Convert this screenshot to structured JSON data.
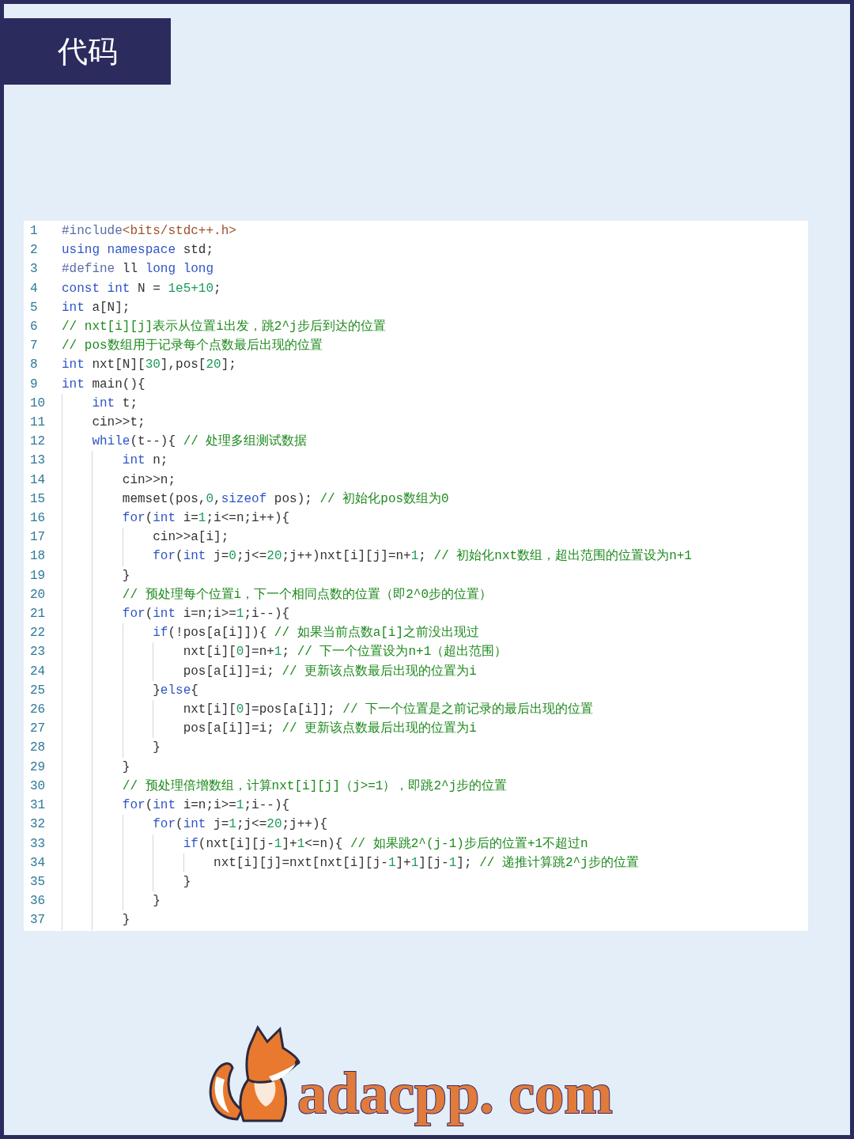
{
  "header": {
    "title": "代码"
  },
  "code": {
    "lines": [
      {
        "number": "1",
        "tokens": [
          {
            "kind": "pre",
            "text": "#include"
          },
          {
            "kind": "str",
            "text": "<bits/stdc++.h>"
          }
        ]
      },
      {
        "number": "2",
        "tokens": [
          {
            "kind": "kw",
            "text": "using"
          },
          {
            "kind": "kw",
            "text": " namespace"
          },
          {
            "kind": "plain",
            "text": " std;"
          }
        ]
      },
      {
        "number": "3",
        "tokens": [
          {
            "kind": "pre",
            "text": "#define"
          },
          {
            "kind": "plain",
            "text": " ll "
          },
          {
            "kind": "kw",
            "text": "long"
          },
          {
            "kind": "kw",
            "text": " long"
          }
        ]
      },
      {
        "number": "4",
        "tokens": [
          {
            "kind": "kw",
            "text": "const"
          },
          {
            "kind": "kw",
            "text": " int"
          },
          {
            "kind": "plain",
            "text": " N = "
          },
          {
            "kind": "num",
            "text": "1e5+10"
          },
          {
            "kind": "plain",
            "text": ";"
          }
        ]
      },
      {
        "number": "5",
        "tokens": [
          {
            "kind": "kw",
            "text": "int"
          },
          {
            "kind": "plain",
            "text": " a[N];"
          }
        ]
      },
      {
        "number": "6",
        "tokens": [
          {
            "kind": "com",
            "text": "// nxt[i][j]表示从位置i出发，跳2^j步后到达的位置"
          }
        ]
      },
      {
        "number": "7",
        "tokens": [
          {
            "kind": "com",
            "text": "// pos数组用于记录每个点数最后出现的位置"
          }
        ]
      },
      {
        "number": "8",
        "tokens": [
          {
            "kind": "kw",
            "text": "int"
          },
          {
            "kind": "plain",
            "text": " nxt[N]["
          },
          {
            "kind": "num",
            "text": "30"
          },
          {
            "kind": "plain",
            "text": "],pos["
          },
          {
            "kind": "num",
            "text": "20"
          },
          {
            "kind": "plain",
            "text": "];"
          }
        ]
      },
      {
        "number": "9",
        "tokens": [
          {
            "kind": "kw",
            "text": "int"
          },
          {
            "kind": "plain",
            "text": " main(){"
          }
        ]
      },
      {
        "number": "10",
        "tokens": [
          {
            "kind": "kw",
            "text": "    int"
          },
          {
            "kind": "plain",
            "text": " t;"
          }
        ]
      },
      {
        "number": "11",
        "tokens": [
          {
            "kind": "plain",
            "text": "    cin>>t;"
          }
        ]
      },
      {
        "number": "12",
        "tokens": [
          {
            "kind": "kw",
            "text": "    while"
          },
          {
            "kind": "plain",
            "text": "(t--){ "
          },
          {
            "kind": "com",
            "text": "// 处理多组测试数据"
          }
        ]
      },
      {
        "number": "13",
        "tokens": [
          {
            "kind": "kw",
            "text": "        int"
          },
          {
            "kind": "plain",
            "text": " n;"
          }
        ]
      },
      {
        "number": "14",
        "tokens": [
          {
            "kind": "plain",
            "text": "        cin>>n;"
          }
        ]
      },
      {
        "number": "15",
        "tokens": [
          {
            "kind": "plain",
            "text": "        memset(pos,"
          },
          {
            "kind": "num",
            "text": "0"
          },
          {
            "kind": "plain",
            "text": ","
          },
          {
            "kind": "kw",
            "text": "sizeof"
          },
          {
            "kind": "plain",
            "text": " pos); "
          },
          {
            "kind": "com",
            "text": "// 初始化pos数组为0"
          }
        ]
      },
      {
        "number": "16",
        "tokens": [
          {
            "kind": "kw",
            "text": "        for"
          },
          {
            "kind": "plain",
            "text": "("
          },
          {
            "kind": "kw",
            "text": "int"
          },
          {
            "kind": "plain",
            "text": " i="
          },
          {
            "kind": "num",
            "text": "1"
          },
          {
            "kind": "plain",
            "text": ";i<=n;i++){"
          }
        ]
      },
      {
        "number": "17",
        "tokens": [
          {
            "kind": "plain",
            "text": "            cin>>a[i];"
          }
        ]
      },
      {
        "number": "18",
        "tokens": [
          {
            "kind": "kw",
            "text": "            for"
          },
          {
            "kind": "plain",
            "text": "("
          },
          {
            "kind": "kw",
            "text": "int"
          },
          {
            "kind": "plain",
            "text": " j="
          },
          {
            "kind": "num",
            "text": "0"
          },
          {
            "kind": "plain",
            "text": ";j<="
          },
          {
            "kind": "num",
            "text": "20"
          },
          {
            "kind": "plain",
            "text": ";j++)nxt[i][j]=n+"
          },
          {
            "kind": "num",
            "text": "1"
          },
          {
            "kind": "plain",
            "text": "; "
          },
          {
            "kind": "com",
            "text": "// 初始化nxt数组，超出范围的位置设为n+1"
          }
        ]
      },
      {
        "number": "19",
        "tokens": [
          {
            "kind": "plain",
            "text": "        }"
          }
        ]
      },
      {
        "number": "20",
        "tokens": [
          {
            "kind": "com",
            "text": "        // 预处理每个位置i，下一个相同点数的位置（即2^0步的位置）"
          }
        ]
      },
      {
        "number": "21",
        "tokens": [
          {
            "kind": "kw",
            "text": "        for"
          },
          {
            "kind": "plain",
            "text": "("
          },
          {
            "kind": "kw",
            "text": "int"
          },
          {
            "kind": "plain",
            "text": " i=n;i>="
          },
          {
            "kind": "num",
            "text": "1"
          },
          {
            "kind": "plain",
            "text": ";i--){"
          }
        ]
      },
      {
        "number": "22",
        "tokens": [
          {
            "kind": "kw",
            "text": "            if"
          },
          {
            "kind": "plain",
            "text": "(!pos[a[i]]){ "
          },
          {
            "kind": "com",
            "text": "// 如果当前点数a[i]之前没出现过"
          }
        ]
      },
      {
        "number": "23",
        "tokens": [
          {
            "kind": "plain",
            "text": "                nxt[i]["
          },
          {
            "kind": "num",
            "text": "0"
          },
          {
            "kind": "plain",
            "text": "]=n+"
          },
          {
            "kind": "num",
            "text": "1"
          },
          {
            "kind": "plain",
            "text": "; "
          },
          {
            "kind": "com",
            "text": "// 下一个位置设为n+1（超出范围）"
          }
        ]
      },
      {
        "number": "24",
        "tokens": [
          {
            "kind": "plain",
            "text": "                pos[a[i]]=i; "
          },
          {
            "kind": "com",
            "text": "// 更新该点数最后出现的位置为i"
          }
        ]
      },
      {
        "number": "25",
        "tokens": [
          {
            "kind": "plain",
            "text": "            }"
          },
          {
            "kind": "kw",
            "text": "else"
          },
          {
            "kind": "plain",
            "text": "{"
          }
        ]
      },
      {
        "number": "26",
        "tokens": [
          {
            "kind": "plain",
            "text": "                nxt[i]["
          },
          {
            "kind": "num",
            "text": "0"
          },
          {
            "kind": "plain",
            "text": "]=pos[a[i]]; "
          },
          {
            "kind": "com",
            "text": "// 下一个位置是之前记录的最后出现的位置"
          }
        ]
      },
      {
        "number": "27",
        "tokens": [
          {
            "kind": "plain",
            "text": "                pos[a[i]]=i; "
          },
          {
            "kind": "com",
            "text": "// 更新该点数最后出现的位置为i"
          }
        ]
      },
      {
        "number": "28",
        "tokens": [
          {
            "kind": "plain",
            "text": "            }"
          }
        ]
      },
      {
        "number": "29",
        "tokens": [
          {
            "kind": "plain",
            "text": "        }"
          }
        ]
      },
      {
        "number": "30",
        "tokens": [
          {
            "kind": "com",
            "text": "        // 预处理倍增数组，计算nxt[i][j]（j>=1），即跳2^j步的位置"
          }
        ]
      },
      {
        "number": "31",
        "tokens": [
          {
            "kind": "kw",
            "text": "        for"
          },
          {
            "kind": "plain",
            "text": "("
          },
          {
            "kind": "kw",
            "text": "int"
          },
          {
            "kind": "plain",
            "text": " i=n;i>="
          },
          {
            "kind": "num",
            "text": "1"
          },
          {
            "kind": "plain",
            "text": ";i--){"
          }
        ]
      },
      {
        "number": "32",
        "tokens": [
          {
            "kind": "kw",
            "text": "            for"
          },
          {
            "kind": "plain",
            "text": "("
          },
          {
            "kind": "kw",
            "text": "int"
          },
          {
            "kind": "plain",
            "text": " j="
          },
          {
            "kind": "num",
            "text": "1"
          },
          {
            "kind": "plain",
            "text": ";j<="
          },
          {
            "kind": "num",
            "text": "20"
          },
          {
            "kind": "plain",
            "text": ";j++){"
          }
        ]
      },
      {
        "number": "33",
        "tokens": [
          {
            "kind": "kw",
            "text": "                if"
          },
          {
            "kind": "plain",
            "text": "(nxt[i][j-"
          },
          {
            "kind": "num",
            "text": "1"
          },
          {
            "kind": "plain",
            "text": "]+"
          },
          {
            "kind": "num",
            "text": "1"
          },
          {
            "kind": "plain",
            "text": "<=n){ "
          },
          {
            "kind": "com",
            "text": "// 如果跳2^(j-1)步后的位置+1不超过n"
          }
        ]
      },
      {
        "number": "34",
        "tokens": [
          {
            "kind": "plain",
            "text": "                    nxt[i][j]=nxt[nxt[i][j-"
          },
          {
            "kind": "num",
            "text": "1"
          },
          {
            "kind": "plain",
            "text": "]+"
          },
          {
            "kind": "num",
            "text": "1"
          },
          {
            "kind": "plain",
            "text": "][j-"
          },
          {
            "kind": "num",
            "text": "1"
          },
          {
            "kind": "plain",
            "text": "]; "
          },
          {
            "kind": "com",
            "text": "// 递推计算跳2^j步的位置"
          }
        ]
      },
      {
        "number": "35",
        "tokens": [
          {
            "kind": "plain",
            "text": "                }"
          }
        ]
      },
      {
        "number": "36",
        "tokens": [
          {
            "kind": "plain",
            "text": "            }"
          }
        ]
      },
      {
        "number": "37",
        "tokens": [
          {
            "kind": "plain",
            "text": "        }"
          }
        ]
      }
    ]
  },
  "logo": {
    "text": "adacpp. com"
  }
}
